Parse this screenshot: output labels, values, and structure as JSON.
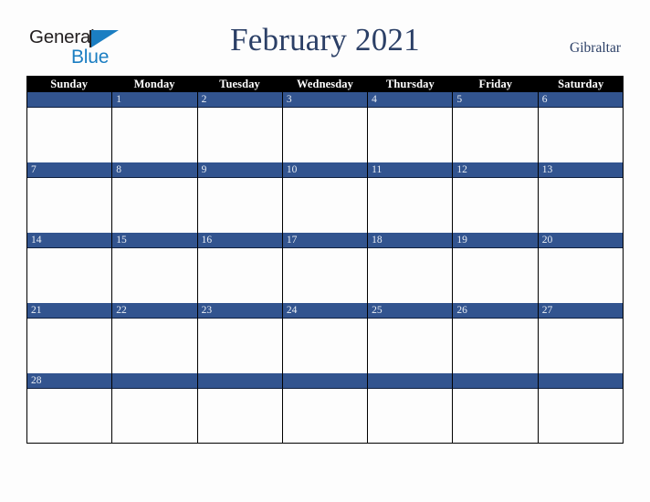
{
  "brand": {
    "name_part1": "General",
    "name_part2": "Blue",
    "triangle_color": "#1b7ec2",
    "text_color": "#231f20"
  },
  "header": {
    "title": "February 2021",
    "subtitle": "Gibraltar",
    "title_color": "#2b3f66"
  },
  "calendar": {
    "month": "February",
    "year": "2021",
    "region": "Gibraltar",
    "header_bg": "#000000",
    "header_text_color": "#ffffff",
    "date_strip_color": "#32548f",
    "date_text_color": "#e9eef5",
    "cell_bg": "#fdfdfd",
    "border_color": "#000000",
    "weekday_headers": [
      "Sunday",
      "Monday",
      "Tuesday",
      "Wednesday",
      "Thursday",
      "Friday",
      "Saturday"
    ],
    "weeks": [
      {
        "days": [
          "",
          "1",
          "2",
          "3",
          "4",
          "5",
          "6"
        ]
      },
      {
        "days": [
          "7",
          "8",
          "9",
          "10",
          "11",
          "12",
          "13"
        ]
      },
      {
        "days": [
          "14",
          "15",
          "16",
          "17",
          "18",
          "19",
          "20"
        ]
      },
      {
        "days": [
          "21",
          "22",
          "23",
          "24",
          "25",
          "26",
          "27"
        ]
      },
      {
        "days": [
          "28",
          "",
          "",
          "",
          "",
          "",
          ""
        ]
      }
    ]
  },
  "page": {
    "background": "#fdfdfd"
  }
}
